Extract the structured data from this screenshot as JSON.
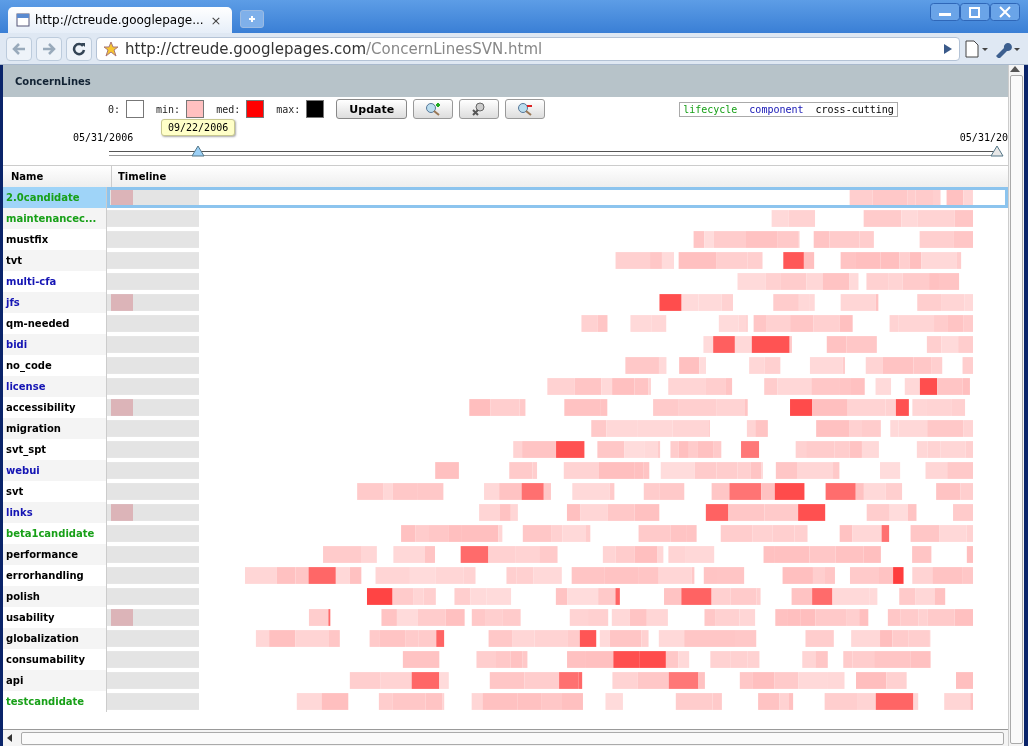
{
  "browser": {
    "tab": {
      "title": "http://ctreude.googlepage...",
      "close": "×"
    },
    "address": {
      "host": "http://ctreude.googlepages.com",
      "path": "/ConcernLinesSVN.html"
    }
  },
  "app": {
    "title": "ConcernLines"
  },
  "colors": [
    {
      "label": "0:",
      "color": "#ffffff"
    },
    {
      "label": "min:",
      "color": "#ffc0c0"
    },
    {
      "label": "med:",
      "color": "#ff0000"
    },
    {
      "label": "max:",
      "color": "#000000"
    }
  ],
  "update_button": "Update",
  "tooltip": "09/22/2006",
  "legend": [
    {
      "label": "lifecycle",
      "kind": "lifecycle"
    },
    {
      "label": "component",
      "kind": "component"
    },
    {
      "label": "cross-cutting",
      "kind": "cross-cutting"
    }
  ],
  "dates": {
    "start": "05/31/2006",
    "end": "05/31/20"
  },
  "slider": {
    "thumbs": [
      {
        "level": 0.1
      },
      {
        "level": 1
      }
    ]
  },
  "table": {
    "columns": [
      "Name",
      "Timeline"
    ],
    "rows": [
      {
        "name": "2.0candidate",
        "kind": "lifecycle",
        "selected": true
      },
      {
        "name": "maintenancec...",
        "kind": "lifecycle",
        "selected": false
      },
      {
        "name": "mustfix",
        "kind": "cross-cutting",
        "selected": false
      },
      {
        "name": "tvt",
        "kind": "cross-cutting",
        "selected": false
      },
      {
        "name": "multi-cfa",
        "kind": "component",
        "selected": false
      },
      {
        "name": "jfs",
        "kind": "component",
        "selected": false
      },
      {
        "name": "qm-needed",
        "kind": "cross-cutting",
        "selected": false
      },
      {
        "name": "bidi",
        "kind": "component",
        "selected": false
      },
      {
        "name": "no_code",
        "kind": "cross-cutting",
        "selected": false
      },
      {
        "name": "license",
        "kind": "component",
        "selected": false
      },
      {
        "name": "accessibility",
        "kind": "cross-cutting",
        "selected": false
      },
      {
        "name": "migration",
        "kind": "cross-cutting",
        "selected": false
      },
      {
        "name": "svt_spt",
        "kind": "cross-cutting",
        "selected": false
      },
      {
        "name": "webui",
        "kind": "component",
        "selected": false
      },
      {
        "name": "svt",
        "kind": "cross-cutting",
        "selected": false
      },
      {
        "name": "links",
        "kind": "component",
        "selected": false
      },
      {
        "name": "beta1candidate",
        "kind": "lifecycle",
        "selected": false
      },
      {
        "name": "performance",
        "kind": "cross-cutting",
        "selected": false
      },
      {
        "name": "errorhandling",
        "kind": "cross-cutting",
        "selected": false
      },
      {
        "name": "polish",
        "kind": "cross-cutting",
        "selected": false
      },
      {
        "name": "usability",
        "kind": "cross-cutting",
        "selected": false
      },
      {
        "name": "globalization",
        "kind": "cross-cutting",
        "selected": false
      },
      {
        "name": "consumability",
        "kind": "cross-cutting",
        "selected": false
      },
      {
        "name": "api",
        "kind": "cross-cutting",
        "selected": false
      },
      {
        "name": "testcandidate",
        "kind": "lifecycle",
        "selected": false
      }
    ]
  }
}
